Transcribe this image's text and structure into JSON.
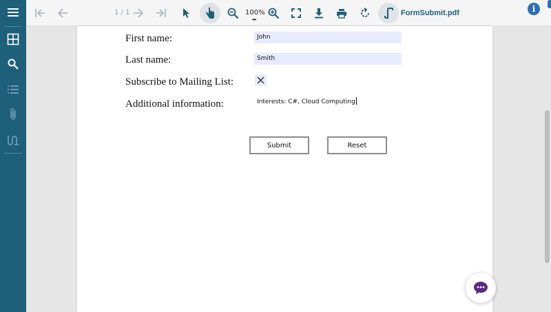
{
  "toolbar": {
    "page_indicator": "1 / 1",
    "zoom": "100%",
    "zoom_more": "•••",
    "file_name": "FormSubmit.pdf",
    "info_label": "i"
  },
  "form": {
    "first_name_label": "First name:",
    "first_name_value": "John",
    "last_name_label": "Last name:",
    "last_name_value": "Smith",
    "subscribe_label": "Subscribe to Mailing List:",
    "additional_label": "Additional information:",
    "additional_value": "Interests: C#, Cloud Computing",
    "submit_label": "Submit",
    "reset_label": "Reset"
  },
  "colors": {
    "sidebar": "#1e5f7a",
    "accent": "#1e5f7a",
    "field_background": "#e8ebff",
    "chat_icon": "#5a2a82"
  },
  "icons": {
    "sidebar": [
      "menu-icon",
      "thumbnails-icon",
      "search-icon",
      "outline-icon",
      "attachment-icon",
      "signature-icon"
    ],
    "toolbar": [
      "first-page-icon",
      "previous-page-icon",
      "next-page-icon",
      "last-page-icon",
      "select-tool-icon",
      "hand-tool-icon",
      "zoom-out-icon",
      "zoom-in-icon",
      "fit-page-icon",
      "download-icon",
      "print-icon",
      "rotate-icon",
      "form-designer-icon",
      "info-icon"
    ],
    "chat": "chat-icon"
  }
}
